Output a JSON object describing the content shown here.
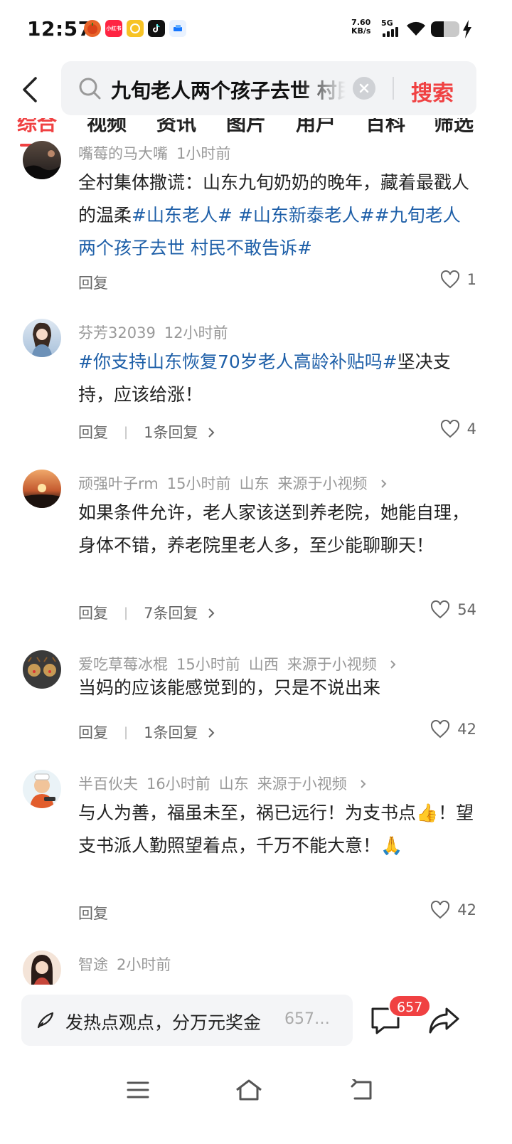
{
  "status_bar": {
    "time": "12:57",
    "net_speed_value": "7.60",
    "net_speed_unit": "KB/s",
    "network": "5G",
    "app_icons": [
      "pumpkin-app-icon",
      "xiaohongshu-icon",
      "coin-app-icon",
      "tiktok-icon",
      "blue-app-icon"
    ],
    "xiaohongshu_label": "小红书",
    "battery_level": 0.45
  },
  "search": {
    "query": "九旬老人两个孩子去世 村民不敢告诉",
    "button_label": "搜索"
  },
  "tabs": [
    "综合",
    "视频",
    "资讯",
    "图片",
    "用户",
    "百科",
    "筛选"
  ],
  "comments": [
    {
      "username": "嘴莓的马大嘴",
      "time": "1小时前",
      "region": "",
      "source": "",
      "text_plain": "全村集体撒谎：山东九旬奶奶的晚年，藏着最戳人的温柔",
      "tags": [
        "#山东老人#",
        "#山东新泰老人#",
        "#九旬老人两个孩子去世 村民不敢告诉#"
      ],
      "reply_label": "回复",
      "reply_count": "",
      "likes": "1"
    },
    {
      "username": "芬芳32039",
      "time": "12小时前",
      "region": "",
      "source": "",
      "tag_lead": "#你支持山东恢复70岁老人高龄补贴吗#",
      "text_plain": "坚决支持，应该给涨！",
      "reply_label": "回复",
      "reply_count": "1条回复",
      "likes": "4"
    },
    {
      "username": "顽强叶子rm",
      "time": "15小时前",
      "region": "山东",
      "source": "来源于小视频",
      "text_plain": "如果条件允许，老人家该送到养老院，她能自理，身体不错，养老院里老人多，至少能聊聊天！",
      "reply_label": "回复",
      "reply_count": "7条回复",
      "likes": "54"
    },
    {
      "username": "爱吃草莓冰棍",
      "time": "15小时前",
      "region": "山西",
      "source": "来源于小视频",
      "text_plain": "当妈的应该能感觉到的，只是不说出来",
      "reply_label": "回复",
      "reply_count": "1条回复",
      "likes": "42"
    },
    {
      "username": "半百伙夫",
      "time": "16小时前",
      "region": "山东",
      "source": "来源于小视频",
      "text_a": "与人为善，福虽未至，祸已远行！为支书点",
      "emoji_a": "👍",
      "text_b": "！望支书派人勤照望着点，千万不能大意！",
      "emoji_b": "🙏",
      "reply_label": "回复",
      "reply_count": "",
      "likes": "42"
    },
    {
      "username": "智途",
      "time": "2小时前",
      "region": "",
      "source": "",
      "text_plain": "",
      "reply_label": "",
      "reply_count": "",
      "likes": ""
    }
  ],
  "bottom_bar": {
    "compose_placeholder": "发热点观点，分万元奖金",
    "compose_count": "657…",
    "comment_badge": "657"
  },
  "colors": {
    "accent_red": "#f04142",
    "hashtag_blue": "#1e5fa8",
    "meta_gray": "#999999"
  }
}
